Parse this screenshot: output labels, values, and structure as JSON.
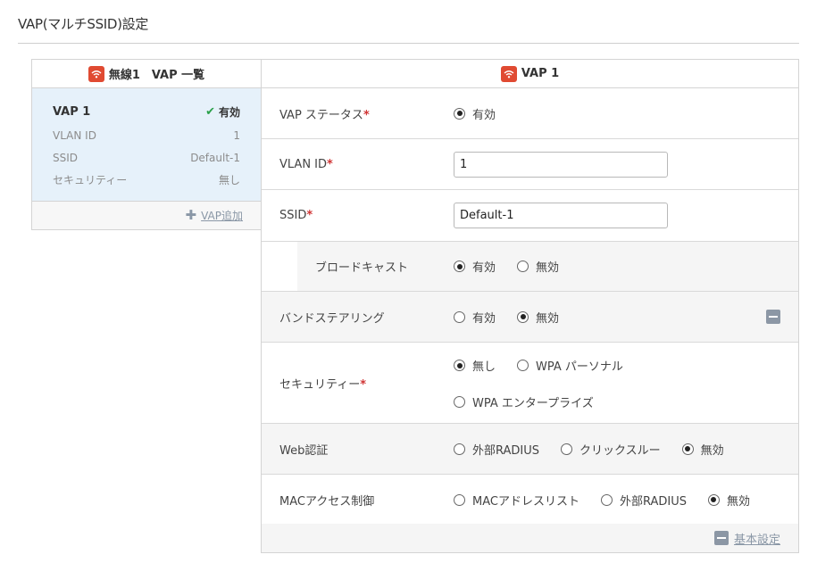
{
  "page": {
    "title": "VAP(マルチSSID)設定"
  },
  "left_panel": {
    "header": "無線1　VAP 一覧",
    "vap_card": {
      "name": "VAP 1",
      "status": "有効",
      "rows": [
        {
          "key": "VLAN ID",
          "value": "1"
        },
        {
          "key": "SSID",
          "value": "Default-1"
        },
        {
          "key": "セキュリティー",
          "value": "無し"
        }
      ]
    },
    "add_label": "VAP追加"
  },
  "right_panel": {
    "header": "VAP 1",
    "vap_status": {
      "label": "VAP ステータス",
      "required": "*",
      "options": [
        "有効"
      ],
      "selected": 0
    },
    "vlan_id": {
      "label": "VLAN ID",
      "required": "*",
      "value": "1"
    },
    "ssid": {
      "label": "SSID",
      "required": "*",
      "value": "Default-1"
    },
    "broadcast": {
      "label": "ブロードキャスト",
      "options": [
        "有効",
        "無効"
      ],
      "selected": 0
    },
    "band_steering": {
      "label": "バンドステアリング",
      "options": [
        "有効",
        "無効"
      ],
      "selected": 1
    },
    "security": {
      "label": "セキュリティー",
      "required": "*",
      "options": [
        "無し",
        "WPA パーソナル",
        "WPA エンタープライズ"
      ],
      "selected": 0
    },
    "web_auth": {
      "label": "Web認証",
      "options": [
        "外部RADIUS",
        "クリックスルー",
        "無効"
      ],
      "selected": 2
    },
    "mac_access": {
      "label": "MACアクセス制御",
      "options": [
        "MACアドレスリスト",
        "外部RADIUS",
        "無効"
      ],
      "selected": 2
    },
    "basic_settings_label": "基本設定"
  },
  "icons": {
    "wifi": "wifi-icon",
    "check": "check-icon",
    "plus": "plus-icon",
    "minus": "minus-icon"
  },
  "colors": {
    "accent_red": "#e04a32",
    "selected_bg": "#e6f1fa",
    "check_green": "#2aa14a",
    "link_gray": "#8a97a6",
    "required_red": "#d03434"
  }
}
